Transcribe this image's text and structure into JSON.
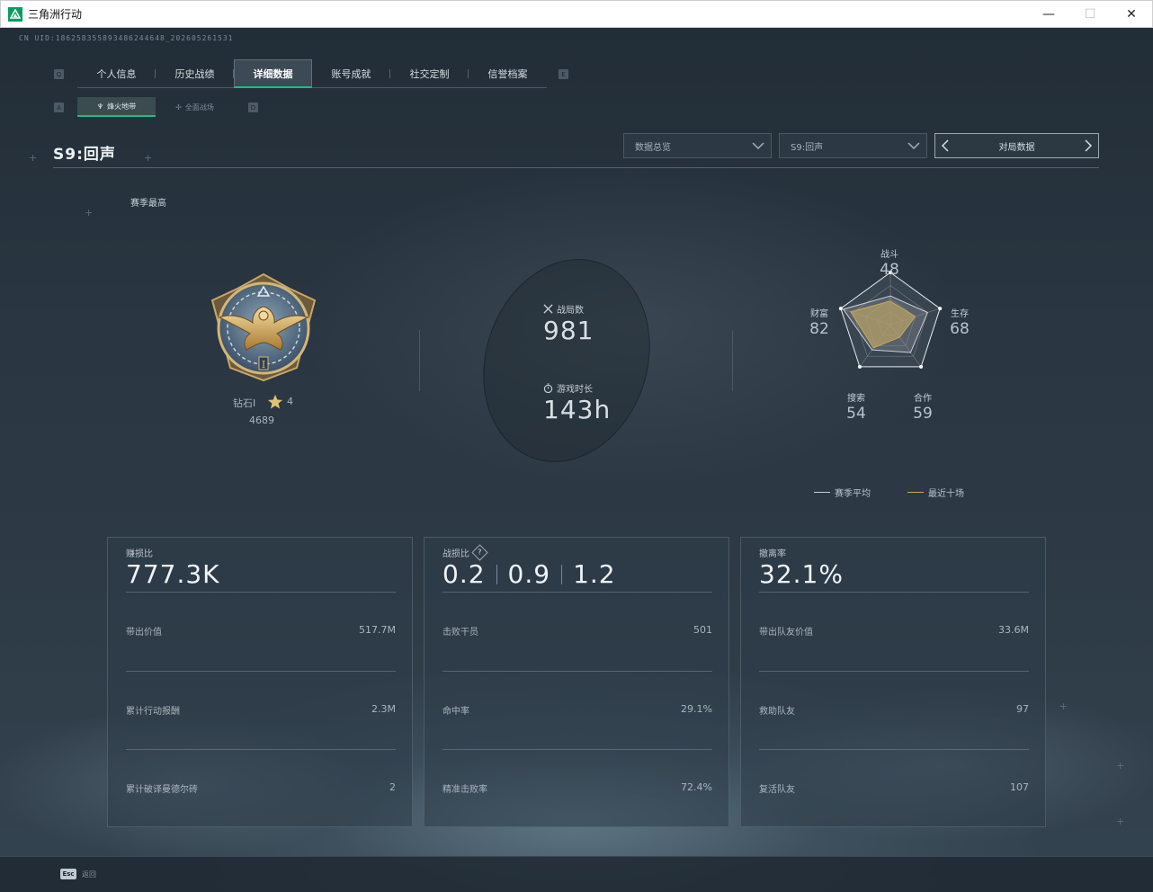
{
  "window": {
    "title": "三角洲行动",
    "minimize": "—",
    "maximize": "☐",
    "close": "✕"
  },
  "uid": "CN UID:186258355893486244648_202605261531",
  "nav": {
    "key_left": "Q",
    "key_right": "E",
    "tabs": [
      "个人信息",
      "历史战绩",
      "详细数据",
      "账号成就",
      "社交定制",
      "信誉档案"
    ],
    "active_tab": "详细数据"
  },
  "subnav": {
    "key_left": "A",
    "key_right": "D",
    "tabs": [
      "烽火地带",
      "全面战场"
    ],
    "active_tab": "烽火地带"
  },
  "season": {
    "title": "S9:回声",
    "best_label": "赛季最高"
  },
  "controls": {
    "dropdown_data": "数据总览",
    "dropdown_season": "S9:回声",
    "match_data": "对局数据"
  },
  "rank": {
    "name": "钻石I",
    "stars": "4",
    "score": "4689"
  },
  "summary": {
    "matches_label": "战局数",
    "matches_value": "981",
    "playtime_label": "游戏时长",
    "playtime_value": "143h"
  },
  "radar": {
    "axes": [
      {
        "name": "战斗",
        "value": "48"
      },
      {
        "name": "生存",
        "value": "68"
      },
      {
        "name": "合作",
        "value": "59"
      },
      {
        "name": "搜索",
        "value": "54"
      },
      {
        "name": "财富",
        "value": "82"
      }
    ],
    "season_avg": [
      0.55,
      0.75,
      0.66,
      0.6,
      0.95
    ],
    "recent_ten": [
      0.45,
      0.5,
      0.3,
      0.55,
      0.8
    ],
    "legend": [
      {
        "label": "赛季平均",
        "color": "#c7ced4"
      },
      {
        "label": "最近十场",
        "color": "#c6a85a"
      }
    ]
  },
  "cards": [
    {
      "label": "赚损比",
      "big": "777.3K",
      "rows": [
        {
          "label": "带出价值",
          "value": "517.7M"
        },
        {
          "label": "累计行动报酬",
          "value": "2.3M"
        },
        {
          "label": "累计破译曼德尔砖",
          "value": "2"
        }
      ]
    },
    {
      "label": "战损比",
      "help": "?",
      "ratios": [
        "0.2",
        "0.9",
        "1.2"
      ],
      "rows": [
        {
          "label": "击败干员",
          "value": "501"
        },
        {
          "label": "命中率",
          "value": "29.1%"
        },
        {
          "label": "精准击败率",
          "value": "72.4%"
        }
      ]
    },
    {
      "label": "撤离率",
      "big": "32.1%",
      "rows": [
        {
          "label": "带出队友价值",
          "value": "33.6M"
        },
        {
          "label": "救助队友",
          "value": "97"
        },
        {
          "label": "复活队友",
          "value": "107"
        }
      ]
    }
  ],
  "footer": {
    "esc_key": "Esc",
    "esc_label": "返回"
  },
  "colors": {
    "accent": "#12c37c",
    "radar_fill": "#b4a06a",
    "radar_bg": "#3e4a55"
  }
}
